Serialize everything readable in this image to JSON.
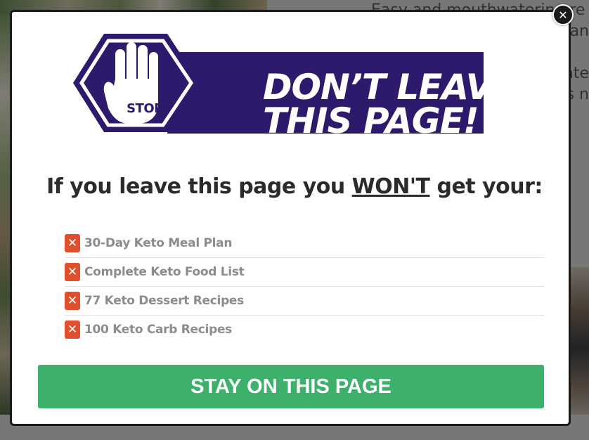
{
  "background": {
    "text_line1": "Easy and mouthwatering re",
    "text_line2": "an",
    "text_line3": "ate",
    "text_line4": "s n"
  },
  "modal": {
    "close_icon": "close-icon",
    "banner": {
      "stop_label": "STOP",
      "line1": "DON’T LEAVE",
      "line2": "THIS PAGE!",
      "colors": {
        "brand": "#2e1a6d"
      }
    },
    "headline": {
      "before": "If you leave this page you ",
      "emphasis": "WON'T",
      "after": " get your:"
    },
    "benefits": [
      "30-Day Keto Meal Plan",
      "Complete Keto Food List",
      "77 Keto Dessert Recipes",
      "100 Keto Carb Recipes"
    ],
    "cta_label": "STAY ON THIS PAGE",
    "colors": {
      "cta": "#3db06b",
      "x_icon": "#e0502c"
    }
  }
}
